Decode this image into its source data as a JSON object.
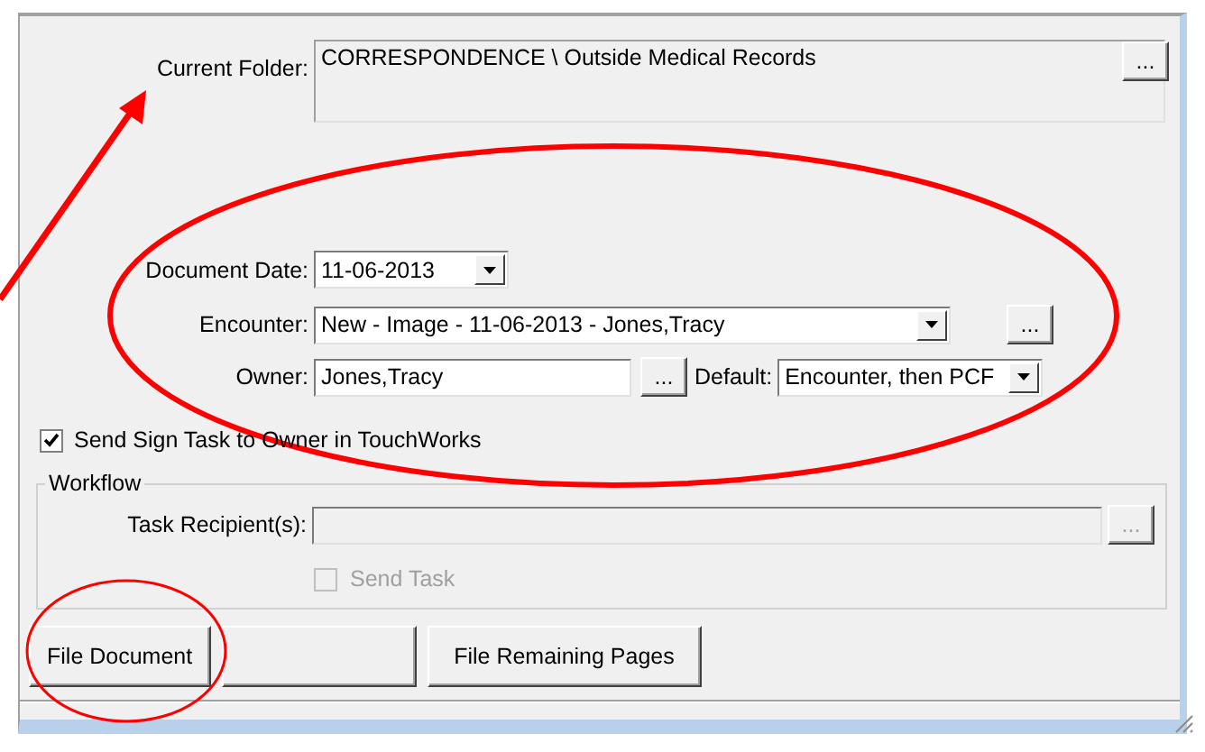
{
  "current_folder": {
    "label": "Current Folder:",
    "value": "CORRESPONDENCE \\ Outside Medical Records",
    "browse": "..."
  },
  "document_date": {
    "label": "Document Date:",
    "value": "11-06-2013"
  },
  "encounter": {
    "label": "Encounter:",
    "value": "New - Image - 11-06-2013 - Jones,Tracy",
    "browse": "..."
  },
  "owner": {
    "label": "Owner:",
    "value": "Jones,Tracy",
    "browse": "..."
  },
  "default": {
    "label": "Default:",
    "value": "Encounter, then PCF"
  },
  "send_sign_task": {
    "label": "Send Sign Task to Owner in TouchWorks",
    "checked": true
  },
  "workflow": {
    "title": "Workflow",
    "task_recipients": {
      "label": "Task Recipient(s):",
      "browse": "...",
      "disabled": true
    },
    "send_task": {
      "label": "Send Task",
      "checked": false,
      "disabled": true
    }
  },
  "buttons": [
    {
      "kind": "text",
      "label": "File Document"
    },
    {
      "kind": "blank"
    },
    {
      "kind": "text",
      "label": "File Remaining Pages"
    }
  ],
  "annotations": [
    {
      "kind": "arrow"
    },
    {
      "kind": "ellipse"
    },
    {
      "kind": "circle"
    }
  ]
}
